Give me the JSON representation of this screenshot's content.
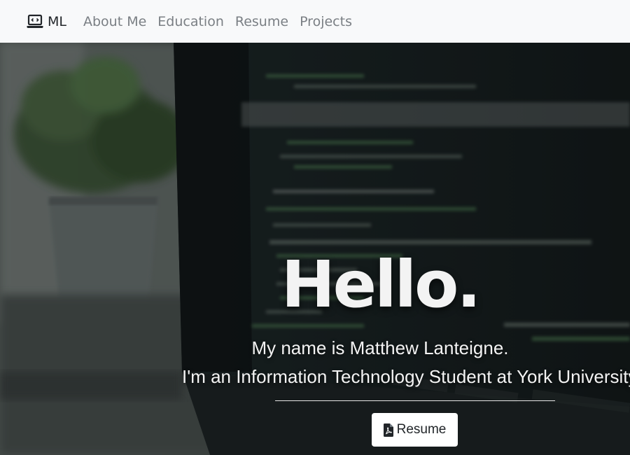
{
  "navbar": {
    "brand": {
      "icon": "laptop-code-icon",
      "label": "ML"
    },
    "links": [
      {
        "label": "About Me"
      },
      {
        "label": "Education"
      },
      {
        "label": "Resume"
      },
      {
        "label": "Projects"
      }
    ]
  },
  "hero": {
    "background": "blurred-laptop-with-code-and-plant-photo",
    "heading": "Hello.",
    "name_line": "My name is Matthew Lanteigne.",
    "role_line": "I'm an Information Technology Student at York University",
    "resume_button": {
      "icon": "file-pdf-icon",
      "label": "Resume"
    }
  },
  "colors": {
    "navbar_bg": "#f8f9fa",
    "nav_link": "#7a7f84",
    "hero_text": "#f3f3f3",
    "button_bg": "#ffffff"
  }
}
